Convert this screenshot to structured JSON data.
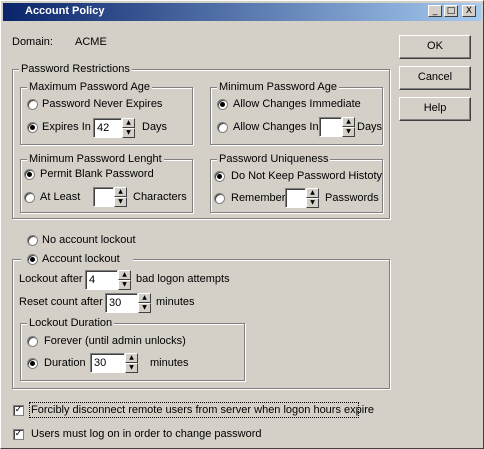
{
  "window": {
    "title": "Account Policy"
  },
  "titlebar_buttons": {
    "minimize": "_",
    "maximize": "□",
    "close": "X"
  },
  "domain": {
    "label": "Domain:",
    "value": "ACME"
  },
  "buttons": {
    "ok": "OK",
    "cancel": "Cancel",
    "help": "Help"
  },
  "password_restrictions": {
    "title": "Password Restrictions",
    "max_age": {
      "title": "Maximum Password Age",
      "never_expires": "Password Never Expires",
      "expires_in": "Expires In",
      "expires_value": "42",
      "days": "Days",
      "selected": "expires_in"
    },
    "min_age": {
      "title": "Minimum Password Age",
      "allow_immediate": "Allow Changes Immediate",
      "allow_in": "Allow Changes In",
      "allow_value": "",
      "days": "Days",
      "selected": "allow_immediate"
    },
    "min_length": {
      "title": "Minimum Password Lenght",
      "permit_blank": "Permit Blank Password",
      "at_least": "At Least",
      "at_least_value": "",
      "characters": "Characters",
      "selected": "permit_blank"
    },
    "uniqueness": {
      "title": "Password Uniqueness",
      "do_not_keep": "Do Not  Keep Password Histoty",
      "remember": "Remember",
      "remember_value": "",
      "passwords": "Passwords",
      "selected": "do_not_keep"
    }
  },
  "lockout": {
    "no_lockout": "No account lockout",
    "account_lockout": "Account lockout",
    "selected": "account_lockout",
    "lockout_after_label": "Lockout after",
    "lockout_after_value": "4",
    "bad_logon": "bad logon attempts",
    "reset_count_label": "Reset count after",
    "reset_count_value": "30",
    "minutes1": "minutes",
    "duration": {
      "title": "Lockout Duration",
      "forever": "Forever (until admin unlocks)",
      "duration_label": "Duration",
      "duration_value": "30",
      "minutes": "minutes",
      "selected": "duration"
    }
  },
  "checkboxes": {
    "disconnect": {
      "label": "Forcibly disconnect remote users from server when logon hours expire",
      "checked": true
    },
    "must_logon": {
      "label": "Users must log on in order to change password",
      "checked": true
    }
  },
  "check_mark": "✓",
  "colors": {
    "face": "#d4d0c8",
    "title_start": "#0a246a",
    "title_end": "#a6caf0"
  }
}
